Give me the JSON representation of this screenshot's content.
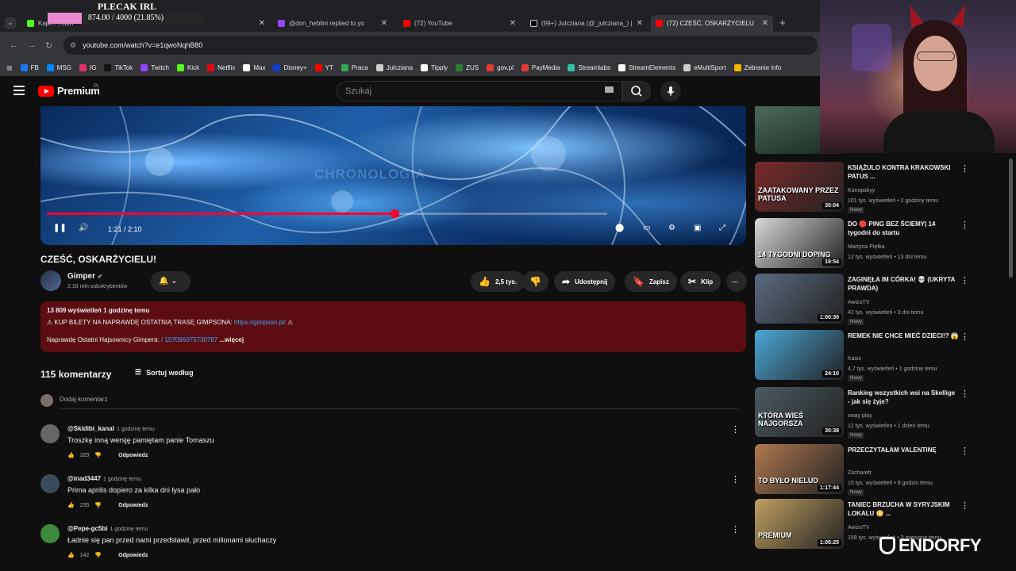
{
  "browser": {
    "tabs": [
      {
        "title": "Kapi... ...itch",
        "color": "#53fc18"
      },
      {
        "title": "@don_heblini replied to yo",
        "color": "#9146ff"
      },
      {
        "title": "(72) YouTube",
        "color": "#ff0000"
      },
      {
        "title": "(99+) Julcziana (@_julcziana_) |",
        "color": "#000000"
      },
      {
        "title": "(72) CZEŚĆ, OSKARŻYCIELU",
        "color": "#ff0000"
      }
    ],
    "url": "youtube.com/watch?v=e1qwoNqhB80",
    "bookmarks": [
      {
        "label": "FB",
        "color": "#1877f2"
      },
      {
        "label": "MSG",
        "color": "#0084ff"
      },
      {
        "label": "IG",
        "color": "#e1306c"
      },
      {
        "label": "TikTok",
        "color": "#111111"
      },
      {
        "label": "Twitch",
        "color": "#9146ff"
      },
      {
        "label": "Kick",
        "color": "#53fc18"
      },
      {
        "label": "Netflix",
        "color": "#e50914"
      },
      {
        "label": "Max",
        "color": "#ffffff"
      },
      {
        "label": "Disney+",
        "color": "#113ccf"
      },
      {
        "label": "YT",
        "color": "#ff0000"
      },
      {
        "label": "Praca",
        "color": "#34a853"
      },
      {
        "label": "Julcziana",
        "color": "#cccccc"
      },
      {
        "label": "Tipply",
        "color": "#ffffff"
      },
      {
        "label": "ZUS",
        "color": "#2e7d32"
      },
      {
        "label": "gov.pl",
        "color": "#e53935"
      },
      {
        "label": "PayMedia",
        "color": "#e53935"
      },
      {
        "label": "Streamlabs",
        "color": "#31c3a2"
      },
      {
        "label": "StreamElements",
        "color": "#ffffff"
      },
      {
        "label": "eMultiSport",
        "color": "#cccccc"
      },
      {
        "label": "Zebranie info",
        "color": "#f4b400"
      }
    ]
  },
  "overlay": {
    "goal_title": "PLECAK IRL",
    "goal_progress": "874.00 / 4000 (21.85%)",
    "goal_fraction": 0.2185,
    "sponsor": "ENDORFY"
  },
  "header": {
    "logo": "Premium",
    "country": "PL",
    "search_placeholder": "Szukaj"
  },
  "video": {
    "watermark": "CHRONOLOGIA",
    "time": "1:21 / 2:10",
    "progress_fraction": 0.62,
    "title": "CZEŚĆ, OSKARŻYCIELU!",
    "channel": "Gimper",
    "subscribers": "2,18 mln subskrybentów",
    "likes": "2,5 tys.",
    "share": "Udostępnij",
    "save": "Zapisz",
    "clip": "Klip"
  },
  "description": {
    "meta": "13 809 wyświetleń  1 godzinę temu",
    "line1_prefix": "⚠ KUP BILETY NA NAPRAWDĘ OSTATNIĄ TRASĘ GIMPSONA: ",
    "line1_link": "https://gimpson.pl/",
    "line1_suffix": " ⚠",
    "line2_prefix": "Naprawdę Ostatni Hajsownicy Gimpera: ",
    "line2_link": "/ 157096075730787",
    "more": "...więcej"
  },
  "comments": {
    "count": "115 komentarzy",
    "sort": "Sortuj według",
    "add_placeholder": "Dodaj komentarz",
    "reply_label": "Odpowiedz",
    "items": [
      {
        "author": "@Skidibi_kanal",
        "when": "1 godzinę temu",
        "text": "Troszkę inną wersję pamiętam panie Tomaszu",
        "likes": "329",
        "avatar": "#666666"
      },
      {
        "author": "@inad3447",
        "when": "1 godzinę temu",
        "text": "Prima aprilis dopiero za kilka dni łysa pało",
        "likes": "235",
        "avatar": "#3a4a5a"
      },
      {
        "author": "@Pepe-gc5bi",
        "when": "1 godzinę temu",
        "text": "Ładnie się pan przed nami przedstawił, przed milionami słuchaczy",
        "likes": "142",
        "avatar": "#3d8a3d"
      }
    ]
  },
  "sidebar": [
    {
      "title": "KSIĄŻULO KONTRA KRAKOWSKI PATUS ...",
      "channel": "Konopskyy",
      "views": "101 tys. wyświetleń • 2 godziny temu",
      "badge": "Nowy",
      "duration": "30:04",
      "thumb_text": "ZAATAKOWANY PRZEZ PATUSA",
      "thumb": "#7a2a2a"
    },
    {
      "title": "DO 🔴 PING BEZ ŚCIEMY| 14 tygodni do startu",
      "channel": "Martyna Piętka",
      "views": "12 tys. wyświetleń • 13 dni temu",
      "badge": "",
      "duration": "19:54",
      "thumb_text": "14 TYGODNI DOPING",
      "thumb": "#d8d8d8"
    },
    {
      "title": "ZAGINĘŁA IM CÓRKA! 💀 (UKRYTA PRAWDA)",
      "channel": "AwizoTV",
      "views": "42 tys. wyświetleń • 3 dni temu",
      "badge": "Nowy",
      "duration": "1:00:30",
      "thumb_text": "",
      "thumb": "#5a6a80"
    },
    {
      "title": "REMEK NIE CHCE MIEĆ DZIECI!? 😱",
      "channel": "Kasix",
      "views": "4,7 tys. wyświetleń • 1 godzinę temu",
      "badge": "Nowy",
      "duration": "24:10",
      "thumb_text": "",
      "thumb": "#4aa8d8"
    },
    {
      "title": "Ranking wszystkich wsi na Skellige - jak się żyje?",
      "channel": "sway play",
      "views": "12 tys. wyświetleń • 1 dzień temu",
      "badge": "Nowy",
      "duration": "30:38",
      "thumb_text": "KTÓRA WIEŚ NAJGORSZA",
      "thumb": "#4a5a60"
    },
    {
      "title": "PRZECZYTAŁAM VALENTINĘ",
      "channel": "Zocharett",
      "views": "15 tys. wyświetleń • 8 godzin temu",
      "badge": "Nowy",
      "duration": "1:17:44",
      "thumb_text": "TO BYŁO NIELUD",
      "thumb": "#b07850"
    },
    {
      "title": "TANIEC BRZUCHA W SYRYJSKIM LOKALU 😳 ...",
      "channel": "AwizoTV",
      "views": "159 tys. wyświetleń • 3 miesiące temu",
      "badge": "",
      "duration": "1:05:25",
      "thumb_text": "PREMIUM",
      "thumb": "#c0a060"
    }
  ]
}
